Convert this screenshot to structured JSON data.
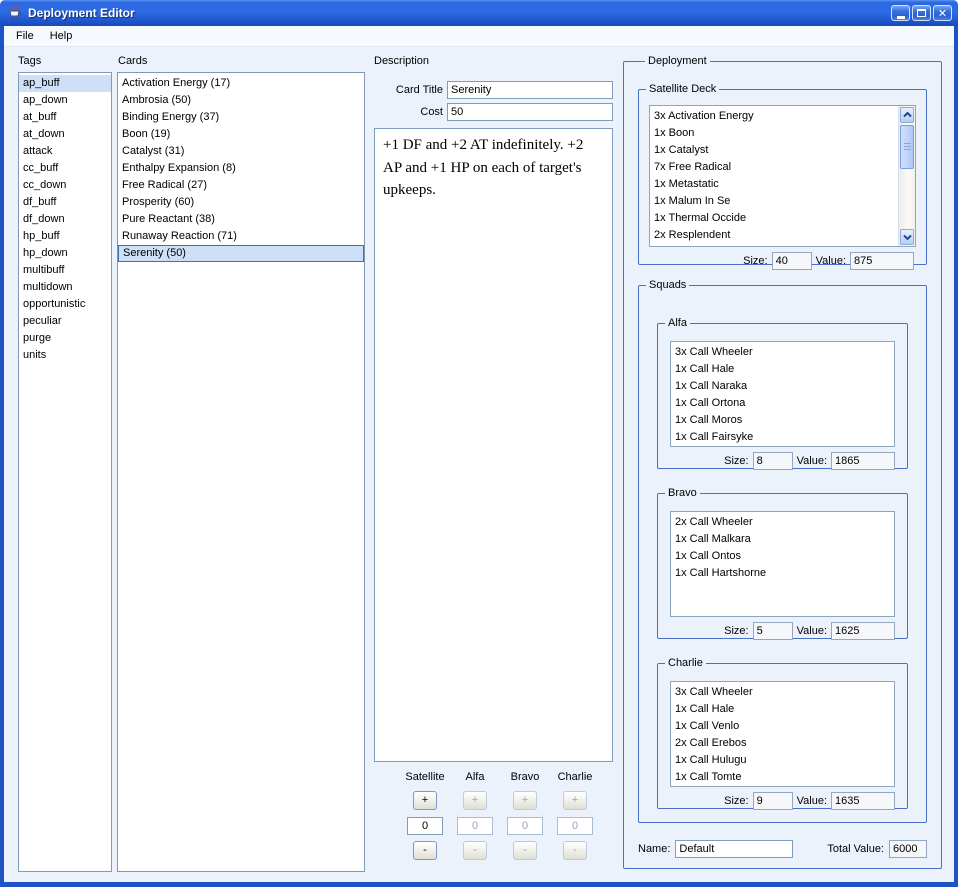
{
  "window": {
    "title": "Deployment Editor"
  },
  "menu": {
    "items": [
      "File",
      "Help"
    ]
  },
  "tags": {
    "label": "Tags",
    "selected_index": 0,
    "items": [
      "ap_buff",
      "ap_down",
      "at_buff",
      "at_down",
      "attack",
      "cc_buff",
      "cc_down",
      "df_buff",
      "df_down",
      "hp_buff",
      "hp_down",
      "multibuff",
      "multidown",
      "opportunistic",
      "peculiar",
      "purge",
      "units"
    ]
  },
  "cards": {
    "label": "Cards",
    "selected_index": 10,
    "items": [
      "Activation Energy (17)",
      "Ambrosia (50)",
      "Binding Energy (37)",
      "Boon (19)",
      "Catalyst (31)",
      "Enthalpy Expansion (8)",
      "Free Radical (27)",
      "Prosperity (60)",
      "Pure Reactant (38)",
      "Runaway Reaction (71)",
      "Serenity (50)"
    ]
  },
  "description": {
    "label": "Description",
    "card_title_label": "Card Title",
    "card_title_value": "Serenity",
    "cost_label": "Cost",
    "cost_value": "50",
    "text": "+1 DF and +2 AT indefinitely. +2 AP and +1 HP on each of target's upkeeps."
  },
  "steppers": {
    "plus_label": "+",
    "minus_label": "-",
    "columns": [
      {
        "label": "Satellite",
        "value": "0",
        "enabled": true
      },
      {
        "label": "Alfa",
        "value": "0",
        "enabled": false
      },
      {
        "label": "Bravo",
        "value": "0",
        "enabled": false
      },
      {
        "label": "Charlie",
        "value": "0",
        "enabled": false
      }
    ]
  },
  "deployment": {
    "label": "Deployment",
    "size_label": "Size:",
    "value_label": "Value:",
    "satellite_deck": {
      "label": "Satellite Deck",
      "items": [
        "3x Activation Energy",
        "1x Boon",
        "1x Catalyst",
        "7x Free Radical",
        "1x Metastatic",
        "1x Malum In Se",
        "1x Thermal Occide",
        "2x Resplendent"
      ],
      "size": "40",
      "value": "875"
    },
    "squads": {
      "label": "Squads",
      "groups": [
        {
          "label": "Alfa",
          "items": [
            "3x Call Wheeler",
            "1x Call Hale",
            "1x Call Naraka",
            "1x Call Ortona",
            "1x Call Moros",
            "1x Call Fairsyke"
          ],
          "size": "8",
          "value": "1865"
        },
        {
          "label": "Bravo",
          "items": [
            "2x Call Wheeler",
            "1x Call Malkara",
            "1x Call Ontos",
            "1x Call Hartshorne"
          ],
          "size": "5",
          "value": "1625"
        },
        {
          "label": "Charlie",
          "items": [
            "3x Call Wheeler",
            "1x Call Hale",
            "1x Call Venlo",
            "2x Call Erebos",
            "1x Call Hulugu",
            "1x Call Tomte"
          ],
          "size": "9",
          "value": "1635"
        }
      ]
    },
    "name_label": "Name:",
    "name_value": "Default",
    "total_value_label": "Total Value:",
    "total_value": "6000"
  },
  "colors": {
    "titlebar_blue": "#2a66e0",
    "window_border": "#1e53c6",
    "content_bg": "#ecf2fb",
    "selection_bg": "#cde0f7",
    "group_border": "#4a6fc8",
    "field_border": "#7f9db9"
  }
}
